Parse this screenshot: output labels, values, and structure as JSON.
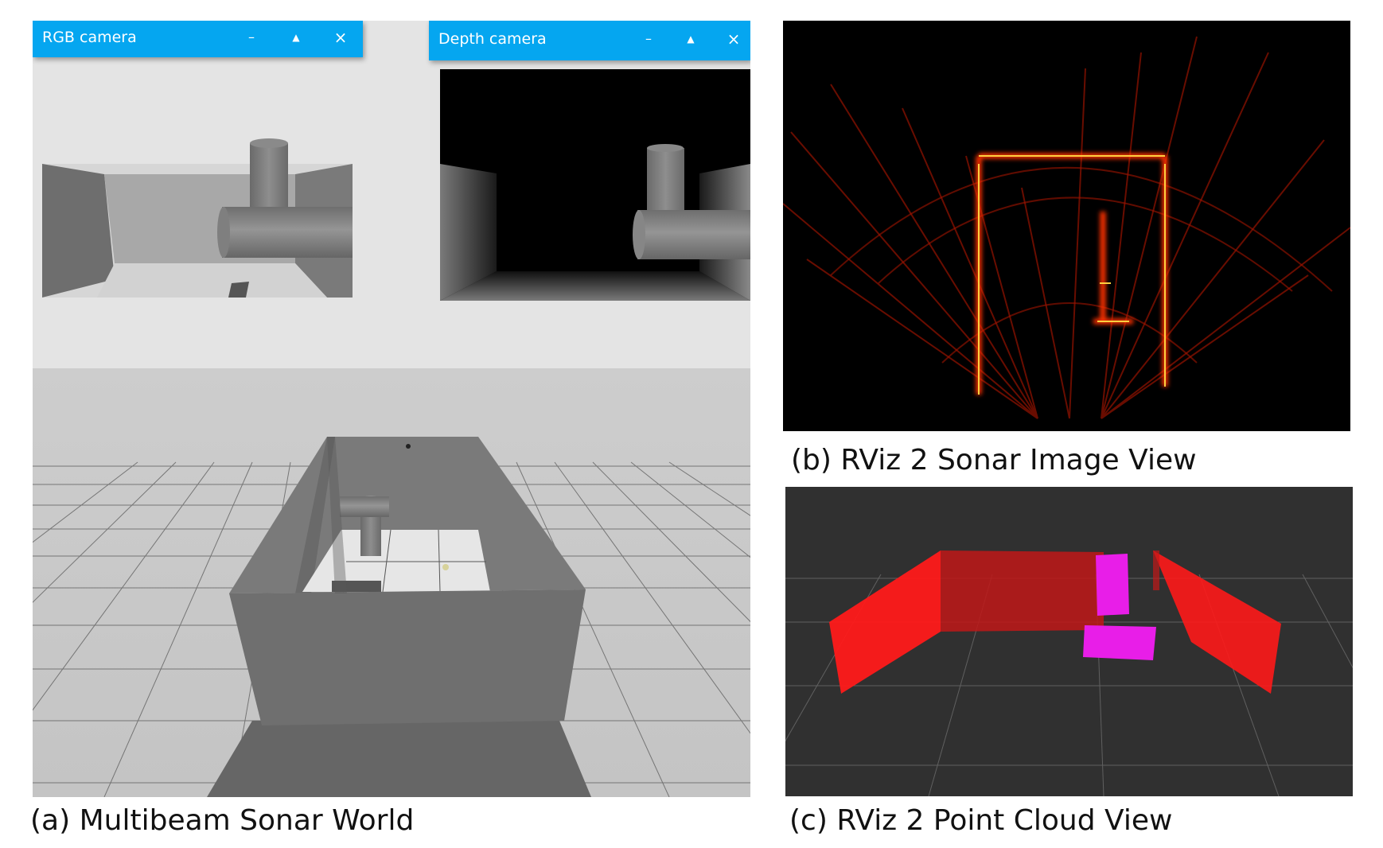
{
  "world_panel": {
    "rgb_window": {
      "title": "RGB camera",
      "minimize": "–",
      "maximize": "▲",
      "close": "×"
    },
    "depth_window": {
      "title": "Depth camera",
      "minimize": "–",
      "maximize": "▲",
      "close": "×"
    }
  },
  "captions": {
    "a": "(a) Multibeam Sonar World",
    "b": "(b) RViz 2 Sonar Image View",
    "c": "(c) RViz 2 Point Cloud View"
  },
  "colors": {
    "window_bar": "#05a6f0",
    "sonar_red": "#ff2a00",
    "sonar_bright": "#ffd040",
    "cloud_red": "#ff1a1a",
    "cloud_magenta": "#e81ee8",
    "cloud_background": "#303030"
  }
}
